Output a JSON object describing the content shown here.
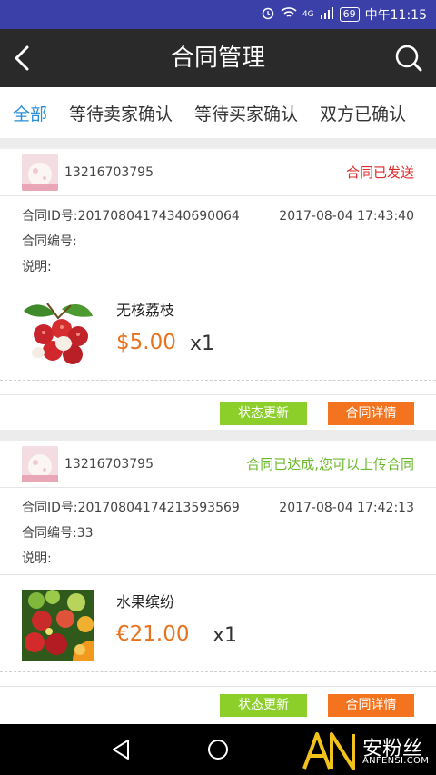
{
  "status_bar": {
    "network": "4G",
    "battery": "69",
    "time": "中午11:15"
  },
  "header": {
    "title": "合同管理"
  },
  "tabs": [
    {
      "label": "全部",
      "active": true
    },
    {
      "label": "等待卖家确认"
    },
    {
      "label": "等待买家确认"
    },
    {
      "label": "双方已确认"
    }
  ],
  "contracts": [
    {
      "phone": "13216703795",
      "status": "合同已发送",
      "status_color": "#e02a2a",
      "id_label": "合同ID号:",
      "id_value": "20170804174340690064",
      "date": "2017-08-04 17:43:40",
      "number_label": "合同编号:",
      "number_value": "",
      "desc_label": "说明:",
      "desc_value": "",
      "product_name": "无核荔枝",
      "price": "$5.00",
      "qty": "x1",
      "update_label": "状态更新",
      "detail_label": "合同详情"
    },
    {
      "phone": "13216703795",
      "status": "合同已达成,您可以上传合同",
      "status_color": "#6cb82c",
      "id_label": "合同ID号:",
      "id_value": "20170804174213593569",
      "date": "2017-08-04 17:42:13",
      "number_label": "合同编号:",
      "number_value": "33",
      "desc_label": "说明:",
      "desc_value": "",
      "product_name": "水果缤纷",
      "price": "€21.00",
      "qty": "x1",
      "update_label": "状态更新",
      "detail_label": "合同详情"
    }
  ],
  "watermark": {
    "text_cn": "安粉丝",
    "text_en": "ANFENSI.COM"
  }
}
